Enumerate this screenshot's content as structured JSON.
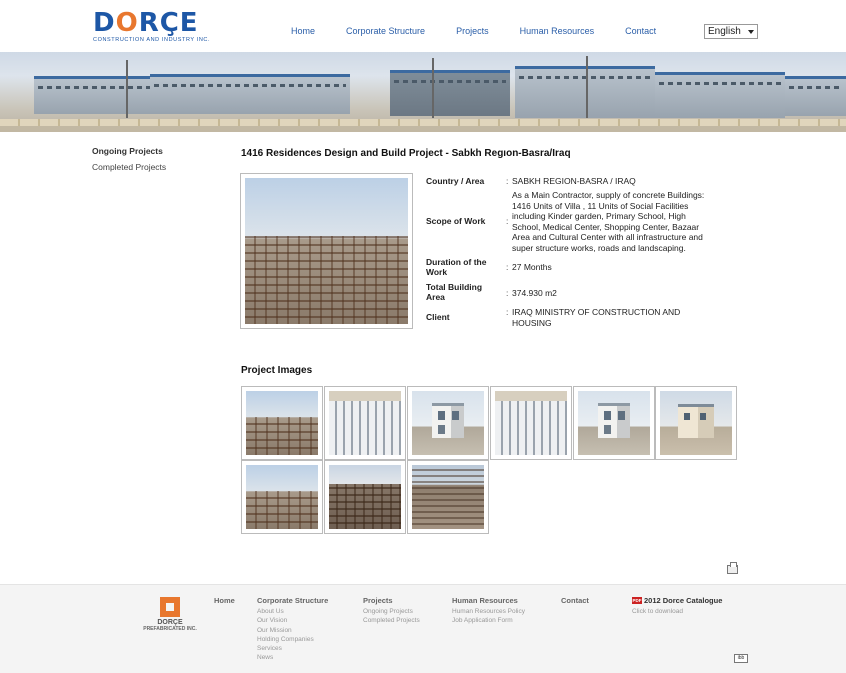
{
  "header": {
    "logo_word_prefix": "D",
    "logo_word_o": "O",
    "logo_word_suffix": "RÇE",
    "logo_subtitle": "CONSTRUCTION AND INDUSTRY INC.",
    "nav": [
      "Home",
      "Corporate Structure",
      "Projects",
      "Human Resources",
      "Contact"
    ],
    "language": "English"
  },
  "sidebar": {
    "items": [
      "Ongoing Projects",
      "Completed Projects"
    ]
  },
  "project": {
    "title": "1416 Residences Design and Build Project - Sabkh Regıon-Basra/Iraq",
    "details": [
      {
        "label": "Country / Area",
        "value": "SABKH REGION-BASRA / IRAQ"
      },
      {
        "label": "Scope of Work",
        "value": "As a Main Contractor, supply of concrete Buildings: 1416 Units of  Villa , 11 Units of Social Facilities including Kinder garden, Primary School, High School, Medical Center, Shopping Center, Bazaar Area and Cultural Center  with all infrastructure and super structure works, roads and landscaping."
      },
      {
        "label": "Duration of the Work",
        "value": "27 Months"
      },
      {
        "label": "Total Building Area",
        "value": "374.930 m2"
      },
      {
        "label": "Client",
        "value": "IRAQ MINISTRY OF CONSTRUCTION AND HOUSING"
      }
    ],
    "colon": ":",
    "images_title": "Project Images",
    "images": [
      "site",
      "aerial",
      "villa",
      "aerial",
      "villa",
      "beige",
      "site",
      "site2",
      "city"
    ]
  },
  "footer": {
    "logo_name": "DORÇE",
    "logo_sub": "PREFABRICATED INC.",
    "columns": [
      {
        "heading": "Home",
        "links": []
      },
      {
        "heading": "Corporate Structure",
        "links": [
          "About Us",
          "Our Vision",
          "Our Mission",
          "Holding Companies",
          "Services",
          "News"
        ]
      },
      {
        "heading": "Projects",
        "links": [
          "Ongoing Projects",
          "Completed Projects"
        ]
      },
      {
        "heading": "Human Resources",
        "links": [
          "Human Resources Policy",
          "Job Application Form"
        ]
      },
      {
        "heading": "Contact",
        "links": []
      }
    ],
    "catalogue_pdf_label": "PDF",
    "catalogue_title": "2012 Dorce Catalogue",
    "catalogue_link": "Click to download",
    "badge": "ibb"
  },
  "colors": {
    "brand_blue": "#1d57a6",
    "brand_orange": "#e8772e",
    "nav_link": "#2a5ea8"
  }
}
